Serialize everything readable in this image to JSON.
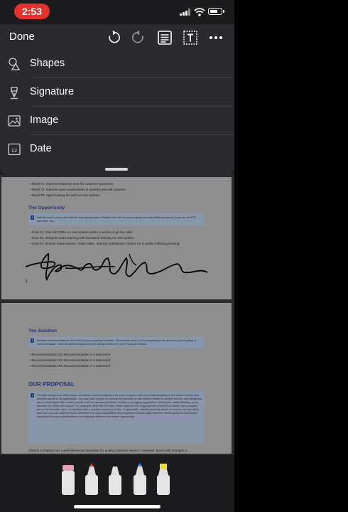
{
  "status": {
    "time": "2:53"
  },
  "toolbar": {
    "done_label": "Done",
    "icons": [
      "undo-icon",
      "redo-icon",
      "annotate-icon",
      "text-box-icon",
      "more-icon"
    ]
  },
  "menu": {
    "items": [
      {
        "label": "Shapes",
        "icon": "shapes-icon"
      },
      {
        "label": "Signature",
        "icon": "pen-nib-icon"
      },
      {
        "label": "Image",
        "icon": "image-icon"
      },
      {
        "label": "Date",
        "icon": "calendar-icon",
        "icon_text": "12"
      }
    ]
  },
  "document": {
    "page1": {
      "bullets_top": [
        "Need #1: Improve response time for customer questions",
        "Need #2: Improve upon weaknesses in upsell/cross-sell volumes",
        "Need #3: rapid training for staff on new system"
      ],
      "section_title": "The Opportunity",
      "callout_text": "Include major points and identify key opportunities. Restate the client's project goals you identified previously (such as via RFP, interview, etc.)",
      "bullets_goals": [
        "Goal #1: Train all CSRs on new system within 6 weeks of go-live date",
        "Goal #2: Integrate sales training with functional training on new system",
        "Goal #3: Monitor sales volume, return rates, and key satisfaction metrics for 6 weeks following training"
      ],
      "page_number": "1"
    },
    "page2": {
      "section_title": "The Solution",
      "callout_text": "Include recommendations that lead to your proposed solution. Summarize what you're proposing to do and how you're going to meet the goals. You'll be able to expand on the details within the 'Our Proposal' section.",
      "bullets": [
        "Recommendation #1: Recommendation # 1 statement",
        "Recommendation #2: Recommendation # 2 statement",
        "Recommendation #3: Recommendation # 3 statement"
      ],
      "proposal_title": "OUR PROPOSAL",
      "proposal_callout": "Provide background information, including a brief background on your company and your understanding of the client's needs and specific issues to be addressed. You may also choose to include the benefits of any related research, project history, and additional factors that impact the client's needs, such as accommodations, trends or emerging regulations. Show your understanding of the benefits the client can expect. For example, describe the risks: what might be lost if appropriate action is not taken and compare this to the benefits they can achieve with a positive course of action. If applicable, identify potential areas of concern for the client and how you can address them. Describe how your capabilities and proposed solution align with the client's goals for the project, including how your qualifications can uniquely address the current opportunity.",
      "footer_text": "Client's Company has a well-deserved reputation for quality customer service. However, faced with changes in"
    }
  },
  "pens": [
    {
      "name": "eraser",
      "color": "#e6a2b2"
    },
    {
      "name": "pen",
      "color": "#d8322a"
    },
    {
      "name": "pen",
      "color": "#111111"
    },
    {
      "name": "pen",
      "color": "#3b8fe0"
    },
    {
      "name": "highlighter",
      "color": "#e9dc3c"
    }
  ]
}
